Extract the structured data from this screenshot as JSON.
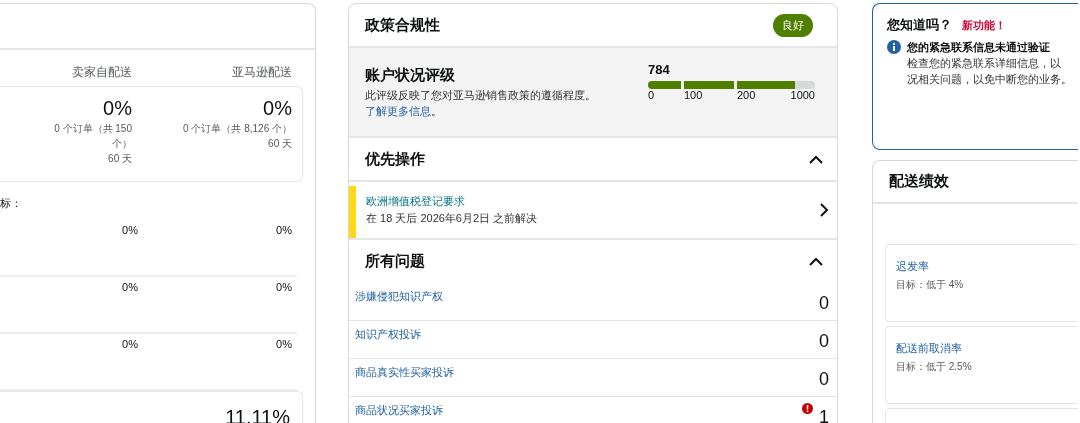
{
  "fulfillment_panel": {
    "columns": [
      "卖家自配送",
      "亚马逊配送"
    ],
    "summary": [
      {
        "value": "0%",
        "orders": "0 个订单（共 150 个）",
        "period": "60 天"
      },
      {
        "value": "0%",
        "orders": "0 个订单（共 8,126 个）",
        "period": "60 天"
      }
    ],
    "target_label": "标：",
    "rows": [
      [
        "0%",
        "0%"
      ],
      [
        "0%",
        "0%"
      ],
      [
        "0%",
        "0%"
      ]
    ],
    "bottom_value": "11.11%"
  },
  "policy": {
    "title": "政策合规性",
    "status": "良好",
    "health": {
      "title": "账户状况评级",
      "description": "此评级反映了您对亚马逊销售政策的遵循程度。",
      "link": "了解更多信息",
      "link_end": "。",
      "score": "784",
      "level": 0.88,
      "ticks": [
        "0",
        "100",
        "200",
        "1000"
      ]
    },
    "priority": {
      "title": "优先操作",
      "expanded": true,
      "items": [
        {
          "title": "欧洲增值税登记要求",
          "subtitle": "在 18 天后 2026年6月2日 之前解决"
        }
      ]
    },
    "issues": {
      "title": "所有问题",
      "expanded": true,
      "rows": [
        {
          "label": "涉嫌侵犯知识产权",
          "count": "0",
          "alert": false
        },
        {
          "label": "知识产权投诉",
          "count": "0",
          "alert": false
        },
        {
          "label": "商品真实性买家投诉",
          "count": "0",
          "alert": false
        },
        {
          "label": "商品状况买家投诉",
          "count": "1",
          "alert": true
        }
      ]
    }
  },
  "notice": {
    "title": "您知道吗？",
    "badge": "新功能！",
    "heading": "您的紧急联系信息未通过验证",
    "lines": [
      "检查您的紧急联系详细信息，以",
      "况相关问题，以免中断您的业务。"
    ]
  },
  "shipping": {
    "title": "配送绩效",
    "metrics": [
      {
        "name": "迟发率",
        "target": "目标：低于 4%"
      },
      {
        "name": "配送前取消率",
        "target": "目标：低于 2.5%"
      }
    ]
  }
}
